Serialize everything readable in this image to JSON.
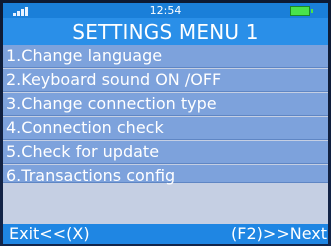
{
  "status_bar": {
    "time": "12:54",
    "signal_icon": "signal-bars-icon",
    "battery_icon": "battery-icon",
    "battery_color": "#49e34a"
  },
  "menu": {
    "title": "SETTINGS MENU 1",
    "items": [
      {
        "label": "1.Change language"
      },
      {
        "label": "2.Keyboard sound ON /OFF"
      },
      {
        "label": "3.Change connection type"
      },
      {
        "label": "4.Connection check"
      },
      {
        "label": "5.Check for update"
      },
      {
        "label": "6.Transactions config"
      }
    ]
  },
  "softkeys": {
    "left": "Exit<<(X)",
    "right": "(F2)>>Next"
  },
  "colors": {
    "status_bar": "#1a7fd9",
    "title_bar": "#2a8fe8",
    "menu_item": "#7da2dc",
    "softkey_bar": "#1f86e3",
    "text": "#ffffff"
  }
}
